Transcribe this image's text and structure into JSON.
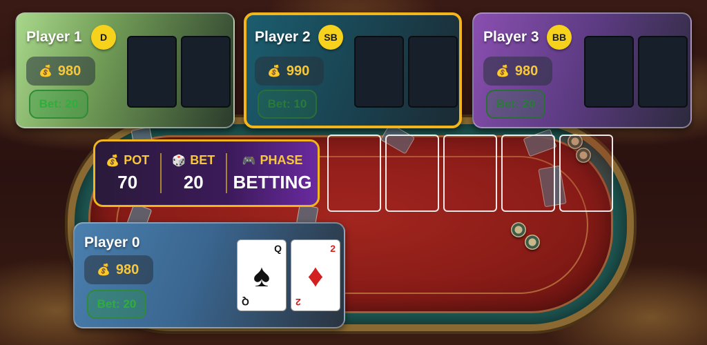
{
  "players": {
    "p1": {
      "name": "Player 1",
      "badge": "D",
      "chips": "980",
      "bet": "Bet: 20"
    },
    "p2": {
      "name": "Player 2",
      "badge": "SB",
      "chips": "990",
      "bet": "Bet: 10"
    },
    "p3": {
      "name": "Player 3",
      "badge": "BB",
      "chips": "980",
      "bet": "Bet: 20"
    },
    "p0": {
      "name": "Player 0",
      "chips": "980",
      "bet": "Bet: 20",
      "cards": [
        {
          "rank": "Q",
          "suit": "♠",
          "color": "black"
        },
        {
          "rank": "2",
          "suit": "♦",
          "color": "red"
        }
      ]
    }
  },
  "icons": {
    "money_bag": "💰",
    "dice": "🎲",
    "gamepad": "🎮"
  },
  "info": {
    "pot_label": "POT",
    "pot_value": "70",
    "bet_label": "BET",
    "bet_value": "20",
    "phase_label": "PHASE",
    "phase_value": "BETTING"
  },
  "colors": {
    "active_border": "#f2b51c",
    "chip_text": "#f7c83a",
    "bet_green": "#2fae3e"
  }
}
